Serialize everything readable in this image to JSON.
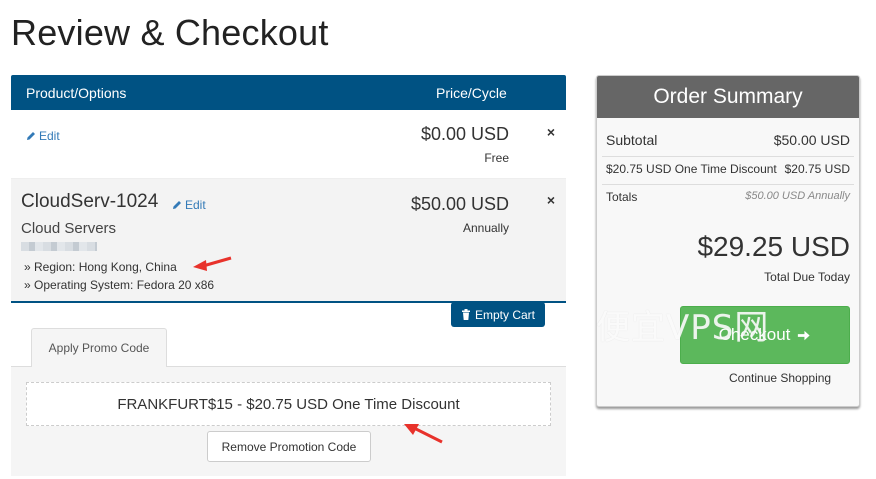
{
  "page": {
    "title": "Review & Checkout"
  },
  "cart": {
    "header": {
      "product_col": "Product/Options",
      "price_col": "Price/Cycle"
    },
    "items": [
      {
        "edit_label": "Edit",
        "price": "$0.00 USD",
        "cycle": "Free"
      },
      {
        "name": "CloudServ-1024",
        "edit_label": "Edit",
        "group": "Cloud Servers",
        "options": [
          "» Region: Hong Kong, China",
          "» Operating System: Fedora 20 x86"
        ],
        "price": "$50.00 USD",
        "cycle": "Annually"
      }
    ],
    "remove_symbol": "×",
    "empty_cart_label": "Empty Cart"
  },
  "promo": {
    "tab_label": "Apply Promo Code",
    "applied_text": "FRANKFURT$15 - $20.75 USD One Time Discount",
    "remove_label": "Remove Promotion Code"
  },
  "summary": {
    "title": "Order Summary",
    "subtotal_label": "Subtotal",
    "subtotal_value": "$50.00 USD",
    "discount_label": "$20.75 USD One Time Discount",
    "discount_value": "$20.75 USD",
    "totals_label": "Totals",
    "totals_value": "$50.00 USD Annually",
    "total_due": "$29.25 USD",
    "total_due_label": "Total Due Today",
    "checkout_label": "Checkout",
    "continue_label": "Continue Shopping"
  },
  "watermark": "便宜VPS网",
  "colors": {
    "header_blue": "#005283",
    "checkout_green": "#5cb85c",
    "annotation_red": "#e8322b"
  }
}
